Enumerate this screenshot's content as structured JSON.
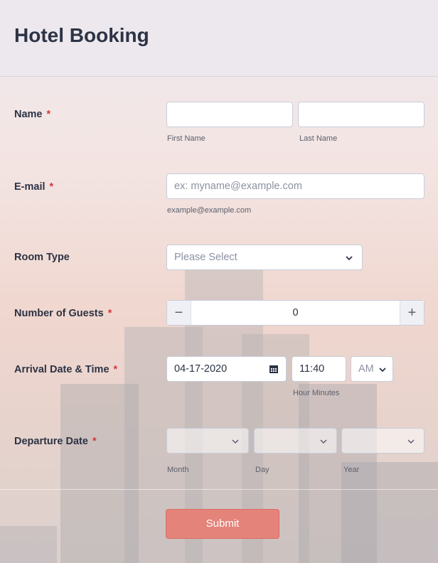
{
  "form": {
    "title": "Hotel Booking",
    "submit_label": "Submit",
    "accent_color": "#e4837a",
    "required_color": "#d33a3a"
  },
  "name": {
    "label": "Name",
    "required_mark": "*",
    "first_caption": "First Name",
    "last_caption": "Last Name",
    "first_value": "",
    "last_value": ""
  },
  "email": {
    "label": "E-mail",
    "required_mark": "*",
    "placeholder": "ex: myname@example.com",
    "caption": "example@example.com"
  },
  "room": {
    "label": "Room Type",
    "selected": "Please Select"
  },
  "guests": {
    "label": "Number of Guests",
    "required_mark": "*",
    "minus": "−",
    "plus": "+",
    "value": "0"
  },
  "arrival": {
    "label": "Arrival Date & Time",
    "required_mark": "*",
    "date": "04-17-2020",
    "time": "11:40",
    "ampm": "AM",
    "time_caption": "Hour Minutes"
  },
  "departure": {
    "label": "Departure Date",
    "required_mark": "*",
    "month_caption": "Month",
    "day_caption": "Day",
    "year_caption": "Year"
  }
}
